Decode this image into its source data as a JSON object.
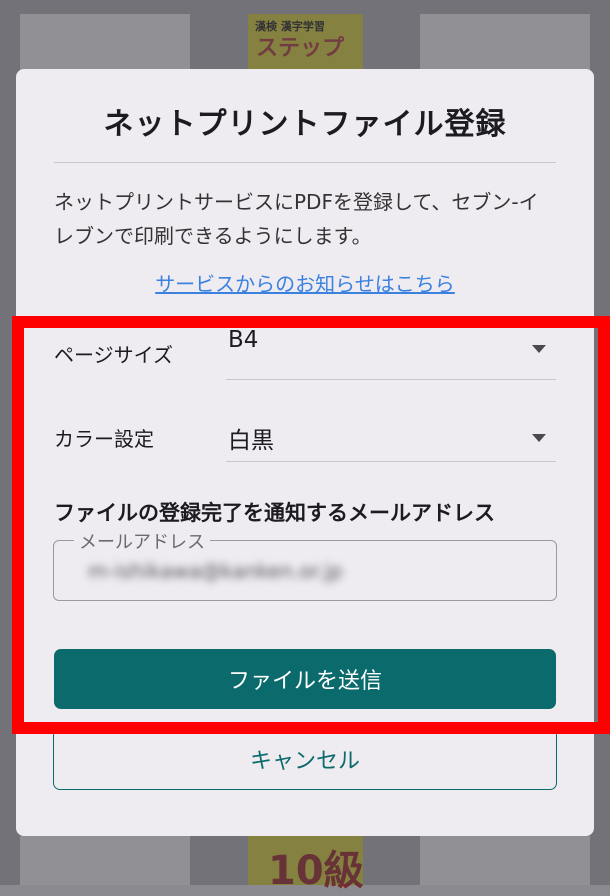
{
  "background": {
    "thumb_top_label": "漢検 漢字学習",
    "thumb_top_big": "ステップ",
    "thumb_bottom_big": "10級"
  },
  "dialog": {
    "title": "ネットプリントファイル登録",
    "description": "ネットプリントサービスにPDFを登録して、セブン-イレブンで印刷できるようにします。",
    "notice_link": "サービスからのお知らせはこちら",
    "page_size": {
      "label": "ページサイズ",
      "value": "B4",
      "icon": "chevron-down-icon"
    },
    "color_setting": {
      "label": "カラー設定",
      "value": "白黒",
      "icon": "chevron-down-icon"
    },
    "email_section_heading": "ファイルの登録完了を通知するメールアドレス",
    "email_field": {
      "label": "メールアドレス",
      "value": "m-ishikawa@kanken.or.jp"
    },
    "submit_button": "ファイルを送信",
    "cancel_button": "キャンセル"
  },
  "colors": {
    "primary": "#0b6a6b",
    "link": "#3b82e0",
    "dialog_bg": "#eeebf1",
    "highlight": "#ff0000"
  }
}
